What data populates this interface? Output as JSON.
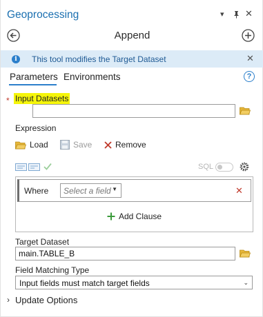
{
  "pane": {
    "title": "Geoprocessing",
    "controls": {
      "menu": "▾",
      "pin": "ᵩ",
      "close": "✕"
    }
  },
  "tool": {
    "name": "Append"
  },
  "info_bar": {
    "message": "This tool modifies the Target Dataset",
    "icon": "info-icon",
    "close": "✕"
  },
  "tabs": [
    {
      "label": "Parameters",
      "active": true
    },
    {
      "label": "Environments",
      "active": false
    }
  ],
  "params": {
    "input_datasets": {
      "label": "Input Datasets",
      "required_marker": "*",
      "value": ""
    },
    "expression": {
      "label": "Expression",
      "toolbar": {
        "load": "Load",
        "save": "Save",
        "remove": "Remove"
      },
      "sql_label": "SQL",
      "sql_enabled": false,
      "where_label": "Where",
      "field_placeholder": "Select a field",
      "add_clause": "Add Clause"
    },
    "target_dataset": {
      "label": "Target Dataset",
      "value": "main.TABLE_B"
    },
    "field_matching": {
      "label": "Field Matching Type",
      "value": "Input fields must match target fields"
    },
    "update_options": {
      "label": "Update Options",
      "expanded": false,
      "toggle": "›"
    }
  },
  "colors": {
    "accent": "#2b7fcb",
    "title": "#1a6fb0",
    "info_bg": "#dcebf7",
    "highlight": "#f5f50a",
    "delete": "#c0392b",
    "add": "#3a9a3a",
    "folder": "#e7b73a"
  }
}
